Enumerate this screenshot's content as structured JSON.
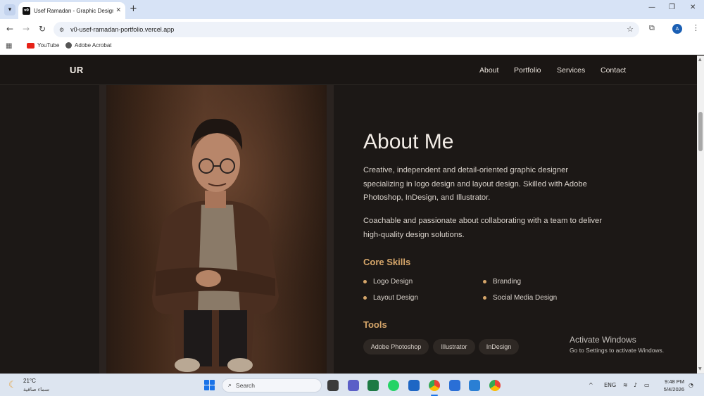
{
  "browser": {
    "tab_title": "Usef Ramadan - Graphic Designer",
    "favicon_text": "v0",
    "url": "v0-usef-ramadan-portfolio.vercel.app",
    "avatar_letter": "A",
    "bookmarks": [
      {
        "label": "YouTube",
        "icon": "youtube-icon"
      },
      {
        "label": "Adobe Acrobat",
        "icon": "acrobat-icon"
      }
    ]
  },
  "site": {
    "logo": "UR",
    "nav": [
      "About",
      "Portfolio",
      "Services",
      "Contact"
    ],
    "heading": "About Me",
    "paragraphs": [
      "Creative, independent and detail-oriented graphic designer specializing in logo design and layout design. Skilled with Adobe Photoshop, InDesign, and Illustrator.",
      "Coachable and passionate about collaborating with a team to deliver high-quality design solutions."
    ],
    "core_skills_title": "Core Skills",
    "skills": [
      "Logo Design",
      "Branding",
      "Layout Design",
      "Social Media Design"
    ],
    "tools_title": "Tools",
    "tools": [
      "Adobe Photoshop",
      "Illustrator",
      "InDesign"
    ],
    "accent_color": "#d6a66a",
    "photo_subject": "Designer portrait with arms crossed"
  },
  "watermark": {
    "title": "Activate Windows",
    "subtitle": "Go to Settings to activate Windows."
  },
  "taskbar": {
    "temperature": "21°C",
    "weather_desc": "سماء صافية",
    "search_placeholder": "Search",
    "language": "ENG",
    "time": "9:48 PM",
    "date": "5/4/2026"
  }
}
